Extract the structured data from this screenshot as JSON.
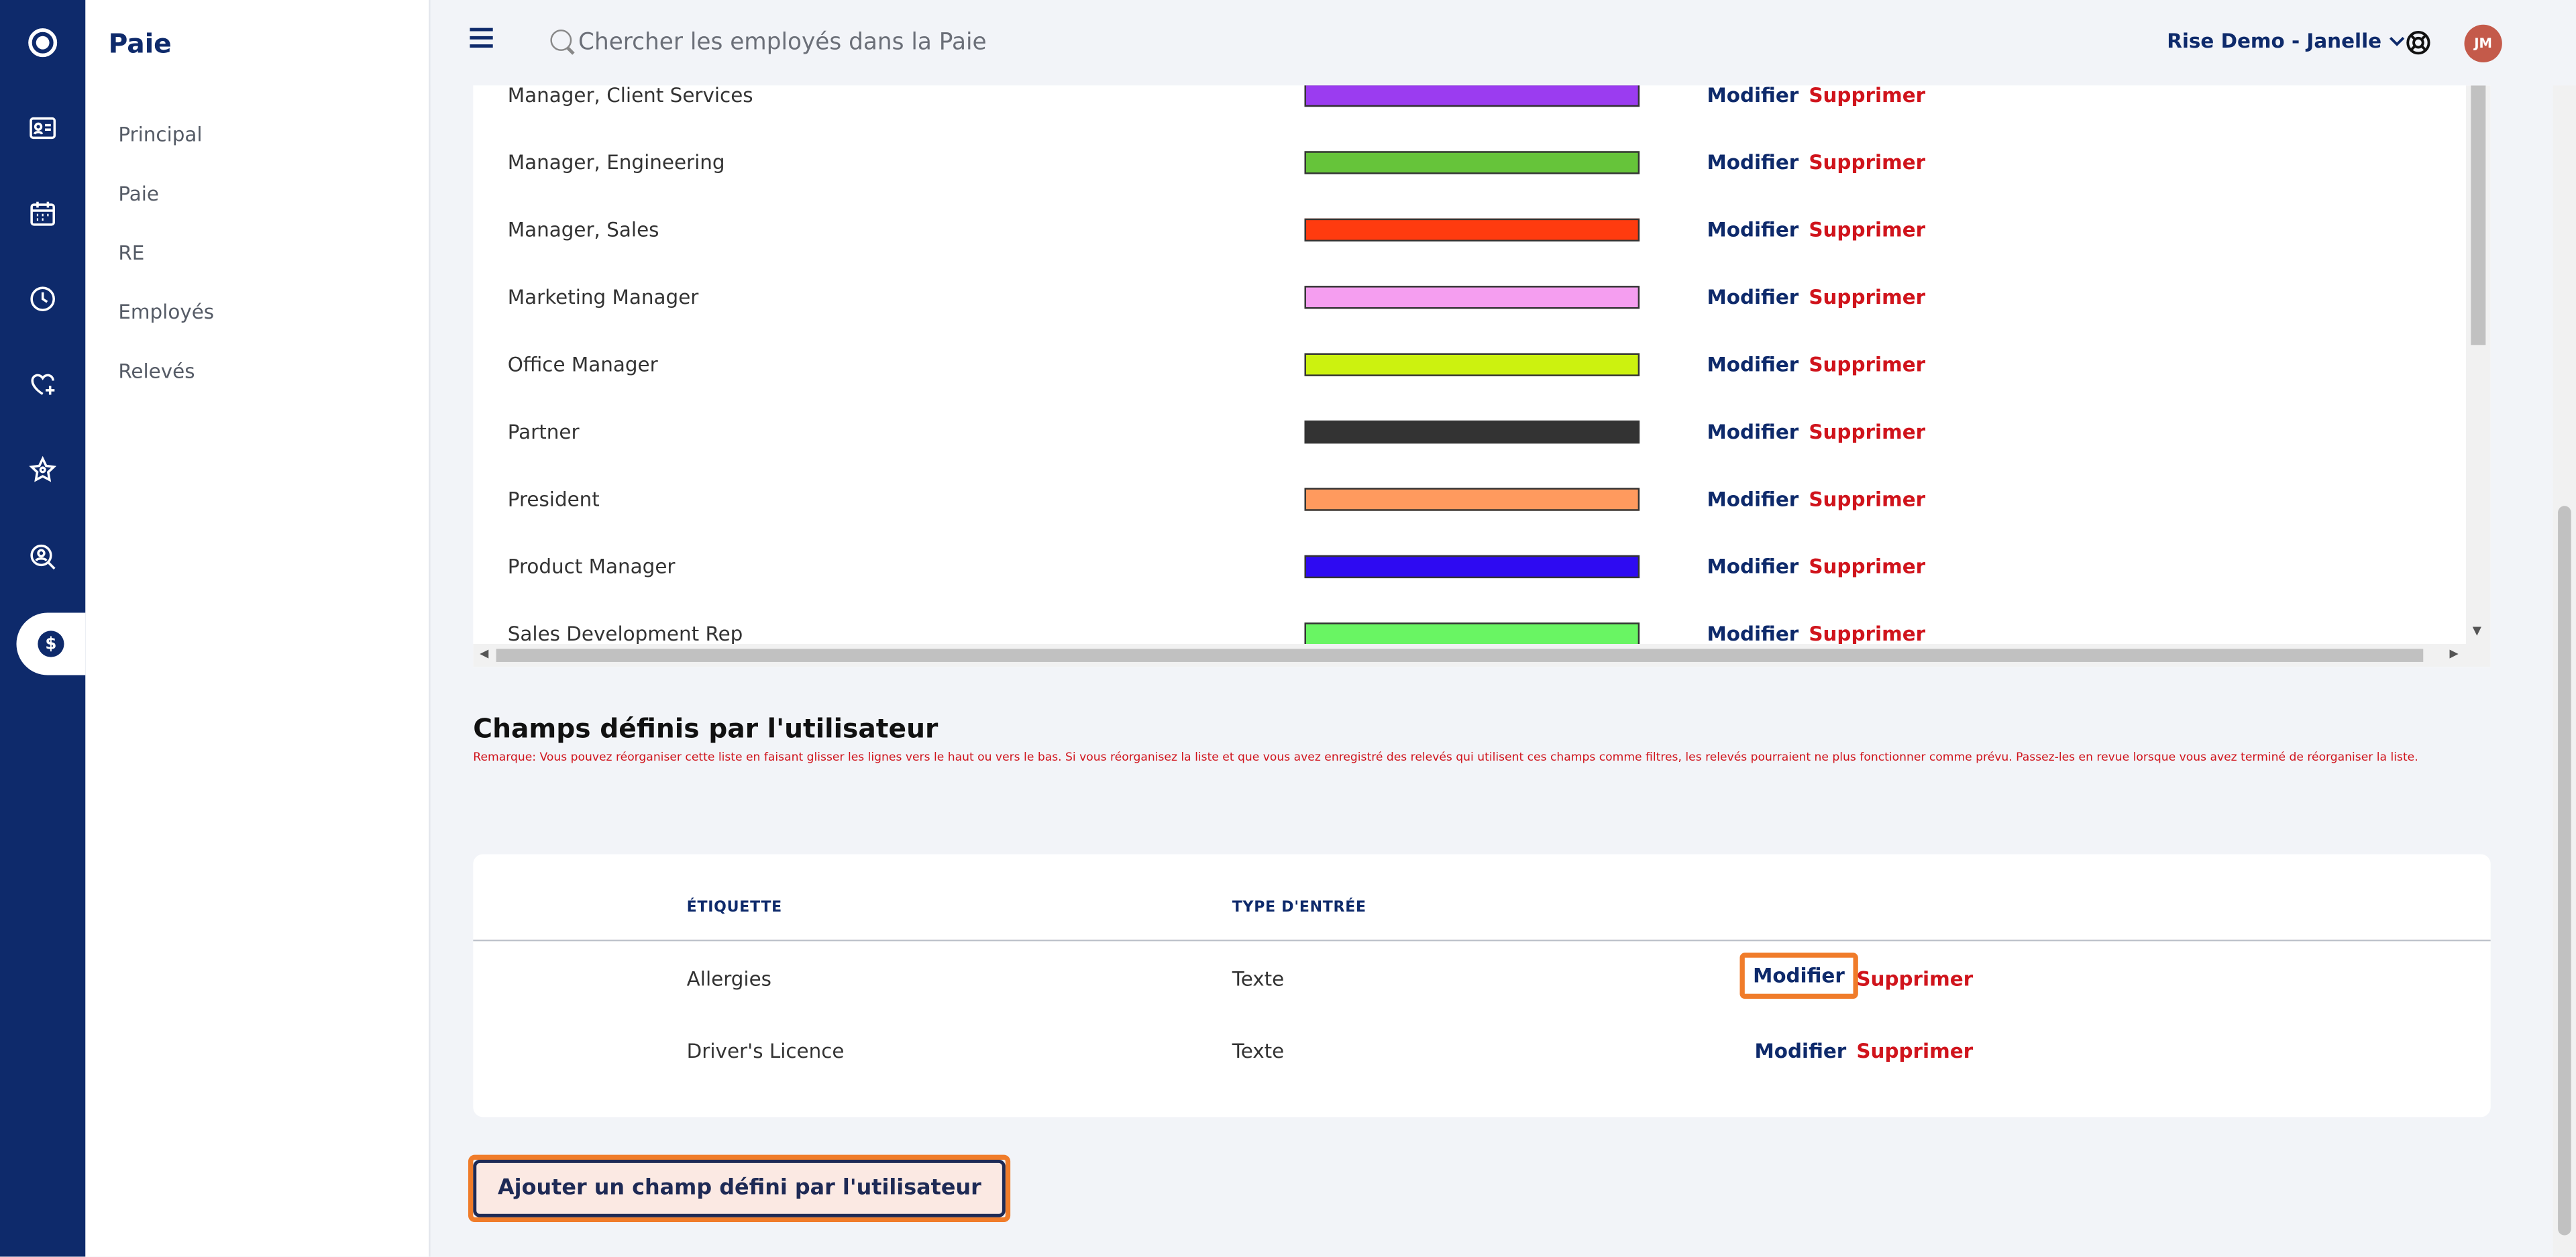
{
  "app": {
    "title": "Paie"
  },
  "sidebar": {
    "items": [
      {
        "label": "Principal"
      },
      {
        "label": "Paie"
      },
      {
        "label": "RE"
      },
      {
        "label": "Employés"
      },
      {
        "label": "Relevés"
      }
    ]
  },
  "rail": {
    "icons": [
      "logo-icon",
      "id-card-icon",
      "calendar-icon",
      "clock-icon",
      "heart-plus-icon",
      "star-icon",
      "search-user-icon",
      "payroll-dollar-icon"
    ]
  },
  "header": {
    "search_placeholder": "Chercher les employés dans la Paie",
    "account": "Rise Demo - Janelle",
    "avatar_initials": "JM"
  },
  "job_titles": {
    "rows": [
      {
        "label": "Manager, Client Services",
        "color": "#9b3cf0",
        "edit": "Modifier",
        "delete": "Supprimer"
      },
      {
        "label": "Manager, Engineering",
        "color": "#66c43a",
        "edit": "Modifier",
        "delete": "Supprimer"
      },
      {
        "label": "Manager, Sales",
        "color": "#ff3b0f",
        "edit": "Modifier",
        "delete": "Supprimer"
      },
      {
        "label": "Marketing Manager",
        "color": "#f59ef0",
        "edit": "Modifier",
        "delete": "Supprimer"
      },
      {
        "label": "Office Manager",
        "color": "#ccf20f",
        "edit": "Modifier",
        "delete": "Supprimer"
      },
      {
        "label": "Partner",
        "color": "#333333",
        "edit": "Modifier",
        "delete": "Supprimer"
      },
      {
        "label": "President",
        "color": "#ff9a5e",
        "edit": "Modifier",
        "delete": "Supprimer"
      },
      {
        "label": "Product Manager",
        "color": "#2e0af2",
        "edit": "Modifier",
        "delete": "Supprimer"
      },
      {
        "label": "Sales Development Rep",
        "color": "#69f563",
        "edit": "Modifier",
        "delete": "Supprimer"
      }
    ]
  },
  "user_fields": {
    "title": "Champs définis par l'utilisateur",
    "note": "Remarque: Vous pouvez réorganiser cette liste en faisant glisser les lignes vers le haut ou vers le bas. Si vous réorganisez la liste et que vous avez enregistré des relevés qui utilisent ces champs comme filtres, les relevés pourraient ne plus fonctionner comme prévu. Passez-les en revue lorsque vous avez terminé de réorganiser la liste.",
    "columns": [
      "ÉTIQUETTE",
      "TYPE D'ENTRÉE"
    ],
    "rows": [
      {
        "label": "Allergies",
        "type": "Texte",
        "edit": "Modifier",
        "delete": "Supprimer"
      },
      {
        "label": "Driver's Licence",
        "type": "Texte",
        "edit": "Modifier",
        "delete": "Supprimer"
      }
    ],
    "add_button": "Ajouter un champ défini par l'utilisateur"
  },
  "colors": {
    "brand": "#0e2a6b",
    "danger": "#d0141c",
    "highlight": "#f07c2a"
  }
}
